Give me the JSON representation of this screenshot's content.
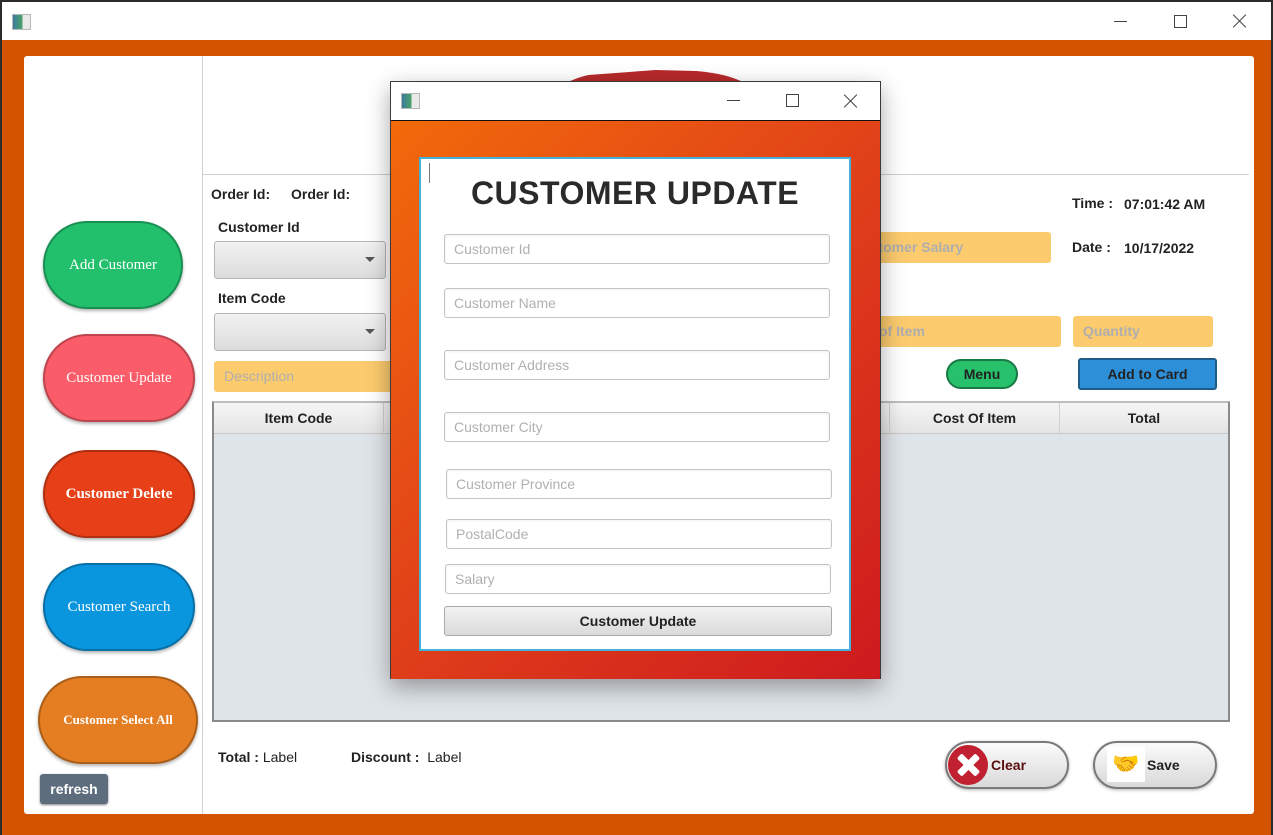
{
  "window": {
    "icon": "app-window-icon",
    "controls": {
      "minimize": "minimize-icon",
      "maximize": "maximize-icon",
      "close": "close-icon"
    }
  },
  "sidebar": {
    "buttons": [
      {
        "label": "Add Customer",
        "color": "#22c06d"
      },
      {
        "label": "Customer Update",
        "color": "#fb5c69"
      },
      {
        "label": "Customer Delete",
        "color": "#e74018"
      },
      {
        "label": "Customer Search",
        "color": "#0996df"
      },
      {
        "label": "Customer Select All",
        "color": "#e57e22"
      }
    ],
    "refresh_label": "refresh"
  },
  "order": {
    "order_id_label": "Order Id:",
    "order_id_value": "Order Id:",
    "customer_id_label": "Customer Id",
    "item_code_label": "Item Code",
    "description_placeholder": "Description",
    "customer_salary_placeholder": "Customer Salary",
    "cost_of_item_placeholder": "Cost of Item",
    "quantity_placeholder": "Quantity",
    "time_label": "Time :",
    "time_value": "07:01:42 AM",
    "date_label": "Date :",
    "date_value": "10/17/2022",
    "menu_label": "Menu",
    "add_to_card_label": "Add  to Card"
  },
  "table": {
    "columns": [
      "Item Code",
      "",
      "",
      "",
      "Cost Of Item",
      "Total"
    ],
    "rows": []
  },
  "footer": {
    "total_label": "Total :",
    "total_value": "Label",
    "discount_label": "Discount :",
    "discount_value": "Label",
    "clear_label": "Clear",
    "save_label": "Save"
  },
  "modal": {
    "title": "CUSTOMER UPDATE",
    "fields": [
      {
        "placeholder": "Customer Id",
        "value": ""
      },
      {
        "placeholder": "Customer Name",
        "value": ""
      },
      {
        "placeholder": "Customer Address",
        "value": ""
      },
      {
        "placeholder": "Customer City",
        "value": ""
      },
      {
        "placeholder": "Customer Province",
        "value": ""
      },
      {
        "placeholder": "PostalCode",
        "value": ""
      },
      {
        "placeholder": "Salary",
        "value": ""
      }
    ],
    "submit_label": "Customer Update"
  },
  "colors": {
    "frame": "#d35400",
    "field_yellow": "#fccb6e",
    "accent_blue": "#2d8fd8",
    "menu_green": "#27c06b"
  }
}
